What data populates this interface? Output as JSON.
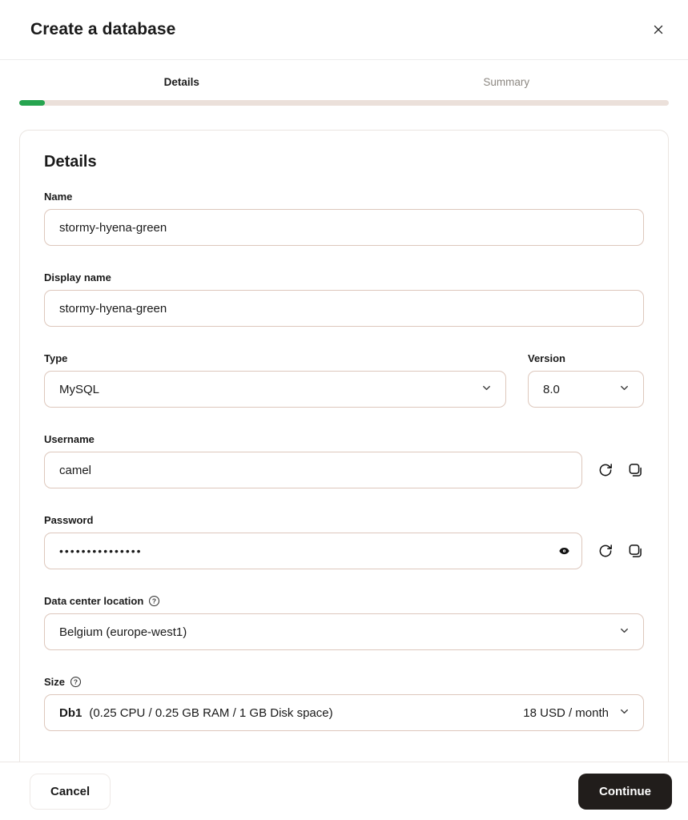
{
  "modal": {
    "title": "Create a database"
  },
  "stepper": {
    "steps": [
      {
        "label": "Details",
        "active": true
      },
      {
        "label": "Summary",
        "active": false
      }
    ],
    "progress_percent": 4,
    "progress_color": "#26a44f",
    "track_color": "#ebe0da"
  },
  "form": {
    "heading": "Details",
    "fields": {
      "name": {
        "label": "Name",
        "value": "stormy-hyena-green"
      },
      "display_name": {
        "label": "Display name",
        "value": "stormy-hyena-green"
      },
      "type": {
        "label": "Type",
        "value": "MySQL"
      },
      "version": {
        "label": "Version",
        "value": "8.0"
      },
      "username": {
        "label": "Username",
        "value": "camel"
      },
      "password": {
        "label": "Password",
        "masked_value": "•••••••••••••••"
      },
      "location": {
        "label": "Data center location",
        "value": "Belgium (europe-west1)"
      },
      "size": {
        "label": "Size",
        "plan": "Db1",
        "specs": "(0.25 CPU / 0.25 GB RAM / 1 GB Disk space)",
        "price": "18 USD / month"
      }
    }
  },
  "footer": {
    "cancel_label": "Cancel",
    "continue_label": "Continue"
  },
  "icons": {
    "close": "×",
    "chevron_down": "˅",
    "regenerate": "↻",
    "copy": "⧉",
    "eye": "👁",
    "help": "?"
  },
  "colors": {
    "input_border": "#ddc7bc",
    "card_border": "#eae5e1",
    "continue_button_bg": "#211d1b",
    "progress_green": "#26a44f"
  }
}
